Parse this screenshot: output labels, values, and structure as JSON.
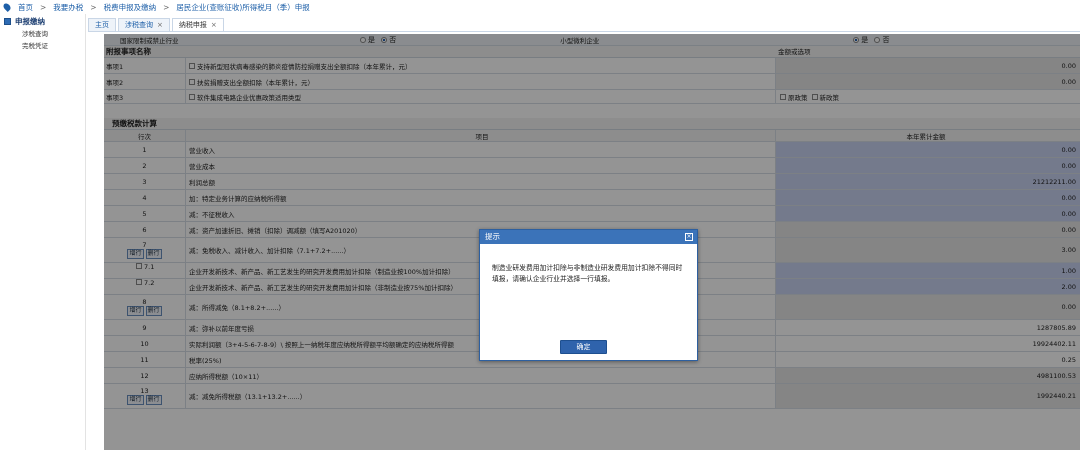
{
  "breadcrumb": {
    "items": [
      "首页",
      "我要办税",
      "税费申报及缴纳",
      "居民企业(查账征收)所得税月（季）申报"
    ],
    "separator": ">"
  },
  "sidebar": {
    "title": "申报缴纳",
    "items": [
      "涉税查询",
      "完税凭证"
    ]
  },
  "tabs": [
    {
      "label": "主页",
      "closable": false,
      "active": false
    },
    {
      "label": "涉税查询",
      "closable": true,
      "active": false
    },
    {
      "label": "纳税申报",
      "closable": true,
      "active": true
    }
  ],
  "tab_close": "×",
  "form": {
    "top_row": {
      "label1": "国家限制或禁止行业",
      "radio_yes": "是",
      "radio_no": "否",
      "label2": "小型微利企业"
    },
    "section1_title": "附报事项名称",
    "section1_amount_header": "金额或选项",
    "section1_rows": [
      {
        "no": "事项1",
        "item": "支持新型冠状病毒感染的肺炎疫情防控捐赠支出全额扣除（本年累计，元）",
        "amount": "0.00"
      },
      {
        "no": "事项2",
        "item": "扶贫捐赠支出全额扣除（本年累计，元）",
        "amount": "0.00"
      },
      {
        "no": "事项3",
        "item": "软件集成电路企业优惠政策适用类型",
        "option_old": "原政策",
        "option_new": "新政策"
      }
    ],
    "section2_title": "预缴税款计算",
    "header": {
      "no": "行次",
      "item": "项目",
      "amount": "本年累计金额"
    },
    "btn_add": "增行",
    "btn_del": "删行",
    "rows": [
      {
        "no": "1",
        "item": "营业收入",
        "amount": "0.00",
        "style": "blue"
      },
      {
        "no": "2",
        "item": "营业成本",
        "amount": "0.00",
        "style": "blue"
      },
      {
        "no": "3",
        "item": "利润总额",
        "amount": "21212211.00",
        "style": "blue"
      },
      {
        "no": "4",
        "item": "加：特定业务计算的应纳税所得额",
        "amount": "0.00",
        "style": "blue"
      },
      {
        "no": "5",
        "item": "减：不征税收入",
        "amount": "0.00",
        "style": "blue"
      },
      {
        "no": "6",
        "item": "减：资产加速折旧、摊销（扣除）调减额（填写A201020）",
        "amount": "0.00",
        "style": "grey"
      },
      {
        "no": "7",
        "item": "减：免税收入、减计收入、加计扣除（7.1+7.2+......）",
        "amount": "3.00",
        "style": "grey",
        "buttons": true
      },
      {
        "no": "7.1",
        "item": "企业开发新技术、新产品、新工艺发生的研究开发费用加计扣除（制造业按100%加计扣除）",
        "amount": "1.00",
        "style": "blue",
        "checkbox": true
      },
      {
        "no": "7.2",
        "item": "企业开发新技术、新产品、新工艺发生的研究开发费用加计扣除（非制造业按75%加计扣除）",
        "amount": "2.00",
        "style": "blue",
        "checkbox": true
      },
      {
        "no": "8",
        "item": "减：所得减免（8.1+8.2+......）",
        "amount": "0.00",
        "style": "grey",
        "buttons": true
      },
      {
        "no": "9",
        "item": "减：弥补以前年度亏损",
        "amount": "1287805.89",
        "style": "none"
      },
      {
        "no": "10",
        "item": "实际利润额（3+4-5-6-7-8-9）\\ 按照上一纳税年度应纳税所得额平均额确定的应纳税所得额",
        "amount": "19924402.11",
        "style": "none"
      },
      {
        "no": "11",
        "item": "税率(25%)",
        "amount": "0.25",
        "style": "none"
      },
      {
        "no": "12",
        "item": "应纳所得税额（10×11）",
        "amount": "4981100.53",
        "style": "grey"
      },
      {
        "no": "13",
        "item": "减：减免所得税额（13.1+13.2+......）",
        "amount": "1992440.21",
        "style": "grey",
        "buttons": true
      }
    ]
  },
  "dialog": {
    "title": "提示",
    "close": "×",
    "message": "制造业研发费用加计扣除与非制造业研发费用加计扣除不得同时填报，请确认企业行业并选择一行填报。",
    "ok_label": "确定"
  }
}
